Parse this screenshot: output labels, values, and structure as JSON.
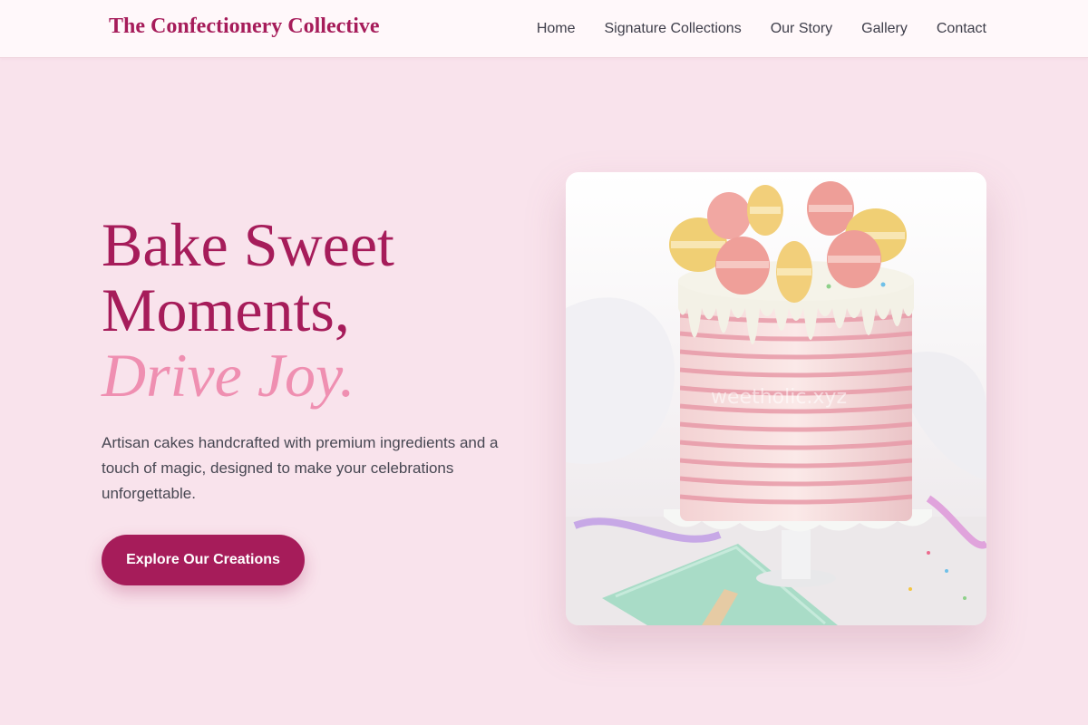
{
  "nav": {
    "brand": "The Confectionery Collective",
    "links": [
      {
        "label": "Home"
      },
      {
        "label": "Signature Collections"
      },
      {
        "label": "Our Story"
      },
      {
        "label": "Gallery"
      },
      {
        "label": "Contact"
      }
    ]
  },
  "hero": {
    "title_line1": "Bake Sweet",
    "title_line2": "Moments,",
    "title_accent": "Drive Joy.",
    "description": "Artisan cakes handcrafted with premium ingredients and a touch of magic, designed to make your celebrations unforgettable.",
    "cta_label": "Explore Our Creations",
    "image": {
      "subject": "pink-striped-drip-cake-with-macarons",
      "watermark": "weetholic.xyz"
    }
  },
  "colors": {
    "brand": "#a61c5a",
    "accent_pink": "#ef8fb1",
    "background": "#f9e3ec",
    "nav_background": "#fff8fa",
    "body_text": "#474752"
  }
}
